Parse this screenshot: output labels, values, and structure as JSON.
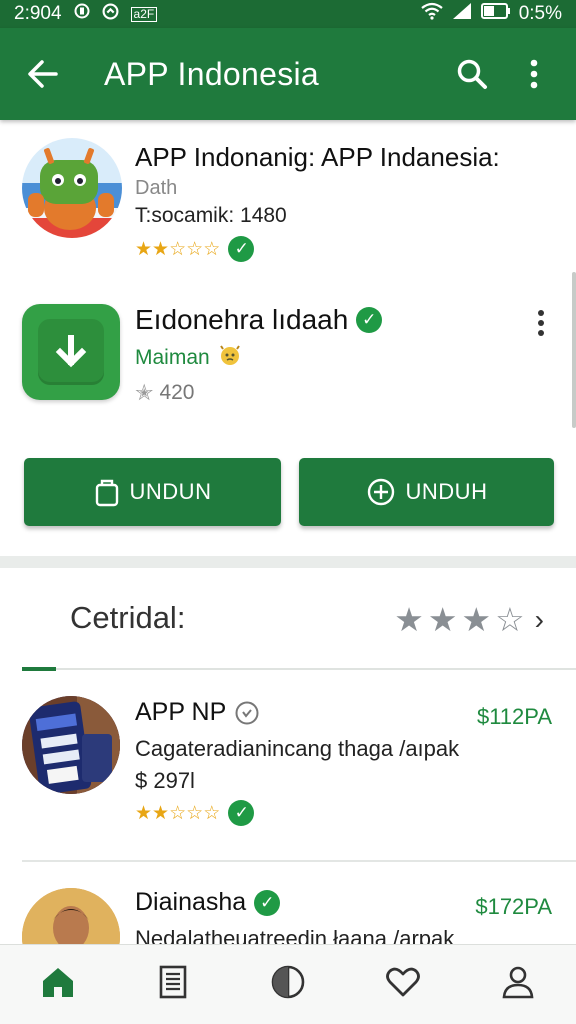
{
  "status_bar": {
    "time": "2:904",
    "temp": "a2F",
    "battery": "0:5%"
  },
  "app_bar": {
    "title": "APP Indonesia",
    "back_icon": "arrow-left-icon",
    "search_icon": "search-icon",
    "more_icon": "more-vert-icon"
  },
  "featured": {
    "title": "APP Indonanig: APP Indanesia:",
    "subtitle": "Dath",
    "count_text": "T:socamik: 1480",
    "rating": 2.5,
    "verified": true
  },
  "app_card": {
    "title": "Eıdonehra lıdaah",
    "developer": "Maiman",
    "downloads": "420",
    "verified": true
  },
  "buttons": {
    "left_label": "UNDUN",
    "right_label": "UNDUH"
  },
  "section": {
    "title": "Cetridal:",
    "rating": 3
  },
  "list": [
    {
      "title": "APP NP",
      "price": "$112PA",
      "description": "Cagateradianincang thaga /aıpak",
      "sub": "$ 297l",
      "rating": 2.5,
      "verified": true
    },
    {
      "title": "Diainasha",
      "price": "$172PA",
      "description": "Nedalatheuatreedin łaana /arpak",
      "verified": true
    }
  ],
  "bottom_nav": {
    "items": [
      "home-icon",
      "document-icon",
      "circle-half-icon",
      "heart-icon",
      "profile-icon"
    ],
    "active": "home-icon"
  },
  "colors": {
    "primary": "#1f7a3d",
    "status_bar": "#1c6b34",
    "accent_green": "#1f9a45",
    "star": "#e8a615"
  }
}
